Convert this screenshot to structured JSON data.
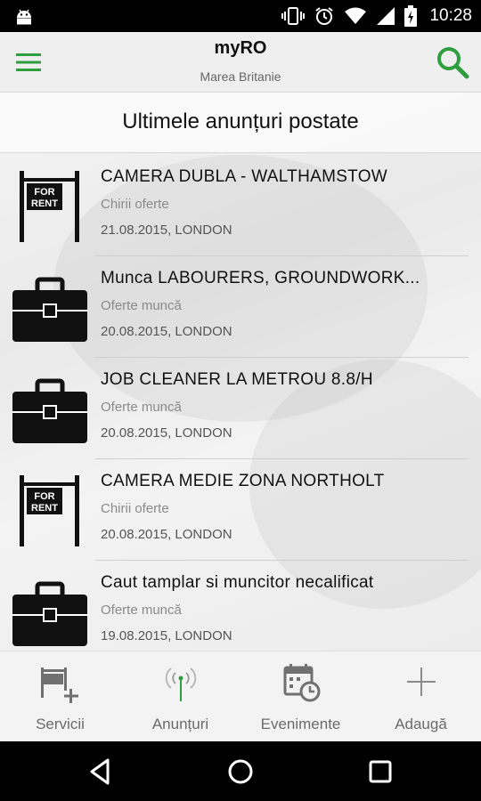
{
  "status_bar": {
    "time": "10:28"
  },
  "app_bar": {
    "title": "myRO",
    "subtitle": "Marea Britanie"
  },
  "section_title": "Ultimele anunțuri postate",
  "listings": [
    {
      "title": "CAMERA DUBLA - WALTHAMSTOW",
      "category": "Chirii oferte",
      "date": "21.08.2015, LONDON",
      "icon": "for-rent-sign-icon",
      "sign_text": [
        "FOR",
        "RENT"
      ]
    },
    {
      "title": "Munca LABOURERS, GROUNDWORK...",
      "category": "Oferte muncă",
      "date": "20.08.2015, LONDON",
      "icon": "briefcase-icon"
    },
    {
      "title": "JOB CLEANER LA METROU 8.8/H",
      "category": "Oferte muncă",
      "date": "20.08.2015, LONDON",
      "icon": "briefcase-icon"
    },
    {
      "title": "CAMERA MEDIE ZONA NORTHOLT",
      "category": "Chirii oferte",
      "date": "20.08.2015, LONDON",
      "icon": "for-rent-sign-icon",
      "sign_text": [
        "FOR",
        "RENT"
      ]
    },
    {
      "title": "Caut tamplar si muncitor necalificat",
      "category": "Oferte muncă",
      "date": "19.08.2015, LONDON",
      "icon": "briefcase-icon"
    }
  ],
  "bottom_nav": [
    {
      "label": "Servicii",
      "icon": "sign-add-icon"
    },
    {
      "label": "Anunțuri",
      "icon": "antenna-icon",
      "active": true
    },
    {
      "label": "Evenimente",
      "icon": "calendar-clock-icon"
    },
    {
      "label": "Adaugă",
      "icon": "plus-icon"
    }
  ],
  "colors": {
    "accent": "#2e9e3e",
    "status_bar": "#000000",
    "app_bar": "#efefef",
    "nav_icon": "#707070"
  }
}
